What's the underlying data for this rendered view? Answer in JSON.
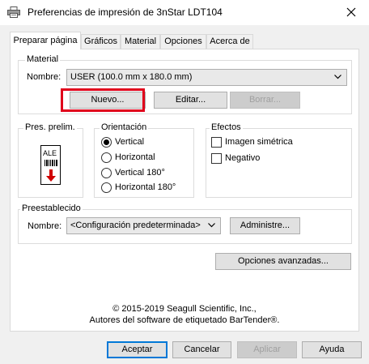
{
  "window": {
    "title": "Preferencias de impresión de 3nStar LDT104",
    "close_icon": "close-icon"
  },
  "tabs": [
    {
      "label": "Preparar página",
      "active": true
    },
    {
      "label": "Gráficos",
      "active": false
    },
    {
      "label": "Material",
      "active": false
    },
    {
      "label": "Opciones",
      "active": false
    },
    {
      "label": "Acerca de",
      "active": false
    }
  ],
  "material": {
    "group_label": "Material",
    "name_label": "Nombre:",
    "name_value": "USER (100.0 mm x 180.0 mm)",
    "new_button": "Nuevo...",
    "edit_button": "Editar...",
    "delete_button": "Borrar...",
    "new_button_highlighted": true
  },
  "preview": {
    "group_label": "Pres. prelim.",
    "label_text": "ALE"
  },
  "orientation": {
    "group_label": "Orientación",
    "options": [
      "Vertical",
      "Horizontal",
      "Vertical 180°",
      "Horizontal 180°"
    ],
    "selected": "Vertical"
  },
  "effects": {
    "group_label": "Efectos",
    "mirror_label": "Imagen simétrica",
    "mirror_checked": false,
    "negative_label": "Negativo",
    "negative_checked": false
  },
  "preset": {
    "group_label": "Preestablecido",
    "name_label": "Nombre:",
    "name_value": "<Configuración predeterminada>",
    "manage_button": "Administre..."
  },
  "advanced_button": "Opciones avanzadas...",
  "copyright": {
    "line1": "© 2015-2019 Seagull Scientific, Inc.,",
    "line2": "Autores del software de etiquetado BarTender®."
  },
  "footer": {
    "accept": "Aceptar",
    "cancel": "Cancelar",
    "apply": "Aplicar",
    "help": "Ayuda"
  },
  "colors": {
    "highlight": "#e0001b",
    "accent": "#0078d7",
    "preview_arrow": "#d00000"
  }
}
